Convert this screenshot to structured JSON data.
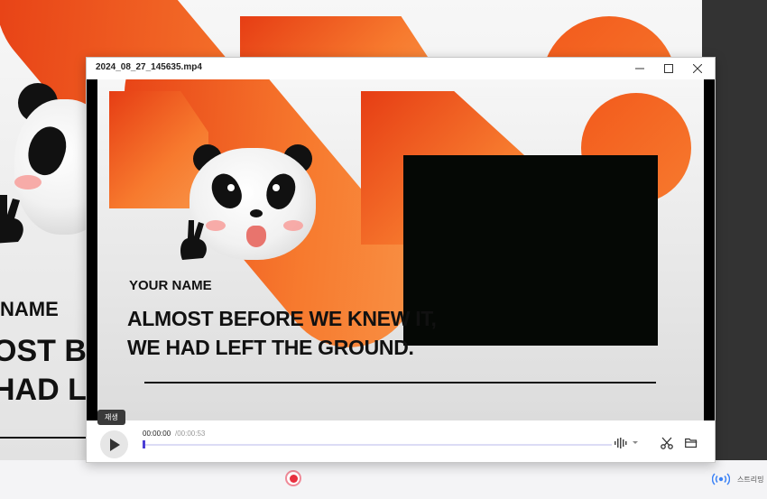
{
  "background": {
    "name_text": "NAME",
    "line1_text": "OST BI",
    "line2_text": "HAD LE"
  },
  "player": {
    "file_name": "2024_08_27_145635.mp4",
    "video": {
      "name_label": "YOUR NAME",
      "headline_line1": "ALMOST BEFORE WE KNEW IT,",
      "headline_line2": "WE HAD LEFT THE GROUND."
    },
    "controls": {
      "tooltip": "재생",
      "current_time": "00:00:00",
      "total_time": "/00:00:53",
      "progress": 0
    }
  },
  "bottom_bar": {
    "stream_label": "스트리밍"
  },
  "colors": {
    "accent_orange": "#f25a1c",
    "progress_accent": "#4b3fd6",
    "record_red": "#e8303f",
    "stream_blue": "#3b82f6"
  }
}
